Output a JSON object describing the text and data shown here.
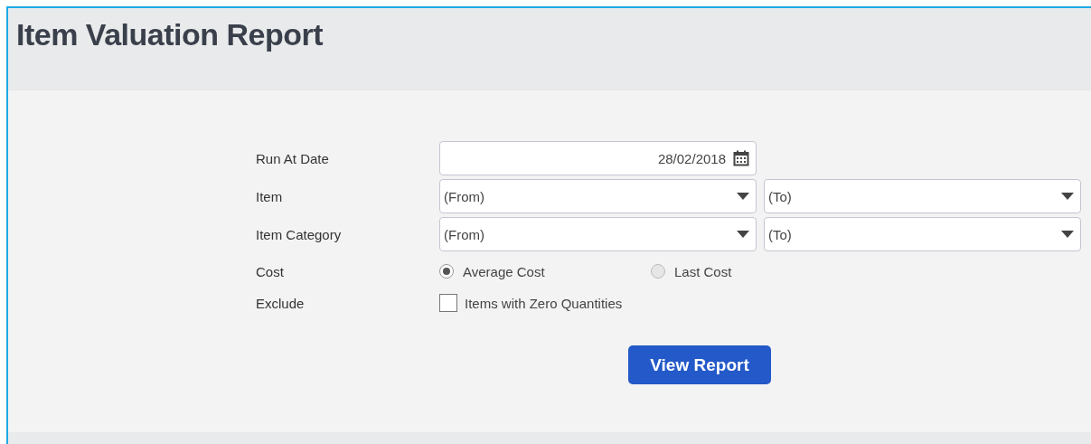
{
  "title": "Item Valuation Report",
  "form": {
    "rows": [
      {
        "kind": "date",
        "label": "Run At Date",
        "value": "28/02/2018"
      },
      {
        "kind": "range",
        "label": "Item",
        "from": "(From)",
        "to": "(To)"
      },
      {
        "kind": "range",
        "label": "Item Category",
        "from": "(From)",
        "to": "(To)"
      },
      {
        "kind": "radio",
        "label": "Cost",
        "options": [
          {
            "label": "Average Cost",
            "selected": true
          },
          {
            "label": "Last Cost",
            "selected": false
          }
        ]
      },
      {
        "kind": "checkbox",
        "label": "Exclude",
        "options": [
          {
            "label": "Items with Zero Quantities",
            "checked": false
          }
        ]
      }
    ]
  },
  "button": "View Report"
}
